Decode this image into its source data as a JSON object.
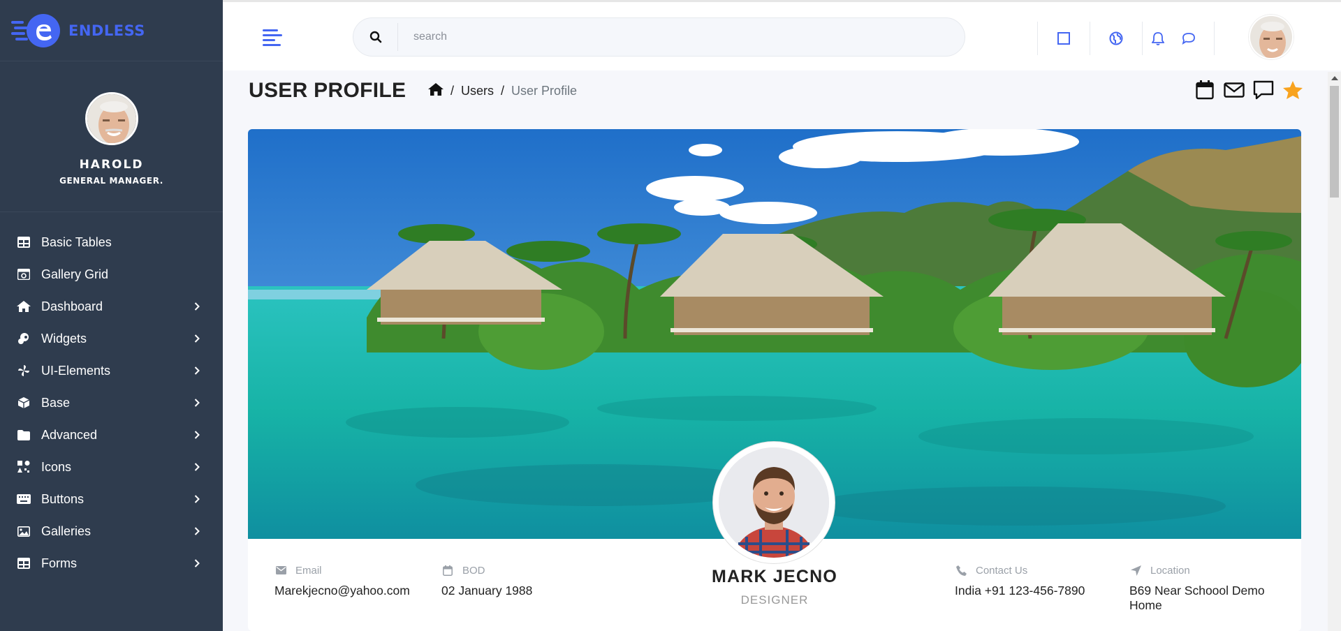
{
  "brand": {
    "name": "ENDLESS",
    "accent": "#4466f2"
  },
  "sidebar": {
    "user": {
      "name": "HAROLD",
      "role": "GENERAL MANAGER."
    },
    "items": [
      {
        "label": "Basic Tables",
        "icon": "table-icon",
        "has_children": false
      },
      {
        "label": "Gallery Grid",
        "icon": "image-icon",
        "has_children": false
      },
      {
        "label": "Dashboard",
        "icon": "home-icon",
        "has_children": true
      },
      {
        "label": "Widgets",
        "icon": "widgets-icon",
        "has_children": true
      },
      {
        "label": "UI-Elements",
        "icon": "pinwheel-icon",
        "has_children": true
      },
      {
        "label": "Base",
        "icon": "box-icon",
        "has_children": true
      },
      {
        "label": "Advanced",
        "icon": "folder-icon",
        "has_children": true
      },
      {
        "label": "Icons",
        "icon": "icons-grid-icon",
        "has_children": true
      },
      {
        "label": "Buttons",
        "icon": "keyboard-icon",
        "has_children": true
      },
      {
        "label": "Galleries",
        "icon": "picture-icon",
        "has_children": true
      },
      {
        "label": "Forms",
        "icon": "form-table-icon",
        "has_children": true
      }
    ]
  },
  "header": {
    "search": {
      "placeholder": "search",
      "value": ""
    },
    "icons": [
      "fullscreen-icon",
      "globe-icon",
      "bell-icon",
      "chat-icon"
    ]
  },
  "page": {
    "title": "USER PROFILE",
    "breadcrumb": [
      "Users",
      "User Profile"
    ],
    "bookmarks": [
      "calendar-icon",
      "mail-icon",
      "message-square-icon",
      "star-icon"
    ]
  },
  "profile": {
    "name": "MARK JECNO",
    "role": "DESIGNER",
    "email_label": "Email",
    "email": "Marekjecno@yahoo.com",
    "bod_label": "BOD",
    "bod": "02 January 1988",
    "contact_label": "Contact Us",
    "contact": "India +91 123-456-7890",
    "location_label": "Location",
    "location": "B69 Near Schoool Demo Home"
  }
}
